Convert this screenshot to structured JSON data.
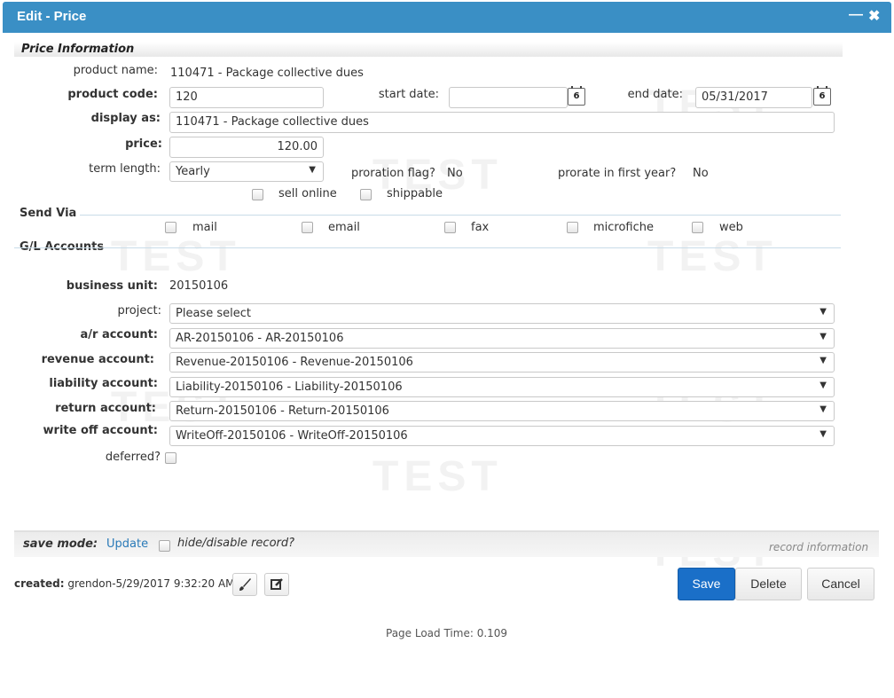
{
  "window": {
    "title": "Edit - Price",
    "minimize_icon": "minus-icon",
    "close_icon": "close-icon"
  },
  "watermark": "TEST",
  "price_info": {
    "section_title": "Price Information",
    "product_name_label": "product name:",
    "product_name_value": "110471 - Package collective dues",
    "product_code_label": "product code:",
    "product_code_value": "120",
    "start_date_label": "start date:",
    "start_date_value": "",
    "end_date_label": "end date:",
    "end_date_value": "05/31/2017",
    "calendar_glyph": "6",
    "display_as_label": "display as:",
    "display_as_value": "110471 - Package collective dues",
    "price_label": "price:",
    "price_value": "120.00",
    "term_length_label": "term length:",
    "term_length_value": "Yearly",
    "proration_flag_label": "proration flag?",
    "proration_flag_value": "No",
    "prorate_first_year_label": "prorate in first year?",
    "prorate_first_year_value": "No",
    "sell_online_label": "sell online",
    "shippable_label": "shippable"
  },
  "send_via": {
    "section_title": "Send Via",
    "options": [
      "mail",
      "email",
      "fax",
      "microfiche",
      "web"
    ]
  },
  "gl_accounts": {
    "section_title": "G/L Accounts",
    "business_unit_label": "business unit:",
    "business_unit_value": "20150106",
    "project_label": "project:",
    "project_value": "Please select",
    "ar_label": "a/r account:",
    "ar_value": "AR-20150106 - AR-20150106",
    "revenue_label": "revenue account:",
    "revenue_value": "Revenue-20150106 - Revenue-20150106",
    "liability_label": "liability account:",
    "liability_value": "Liability-20150106 - Liability-20150106",
    "return_label": "return account:",
    "return_value": "Return-20150106 - Return-20150106",
    "writeoff_label": "write off account:",
    "writeoff_value": "WriteOff-20150106 - WriteOff-20150106",
    "deferred_label": "deferred?"
  },
  "footer": {
    "save_mode_label": "save mode:",
    "save_mode_value": "Update",
    "hide_disable_label": "hide/disable record?",
    "record_info_label": "record information",
    "created_label": "created:",
    "created_value": "grendon-5/29/2017 9:32:20 AM",
    "brush_icon": "brush-icon",
    "edit_icon": "edit-icon",
    "save_label": "Save",
    "delete_label": "Delete",
    "cancel_label": "Cancel",
    "page_load_text": "Page Load Time: 0.109"
  },
  "colors": {
    "titlebar": "#3a8fc5",
    "primary_button": "#1a6fc8",
    "link": "#2a7ab8"
  }
}
